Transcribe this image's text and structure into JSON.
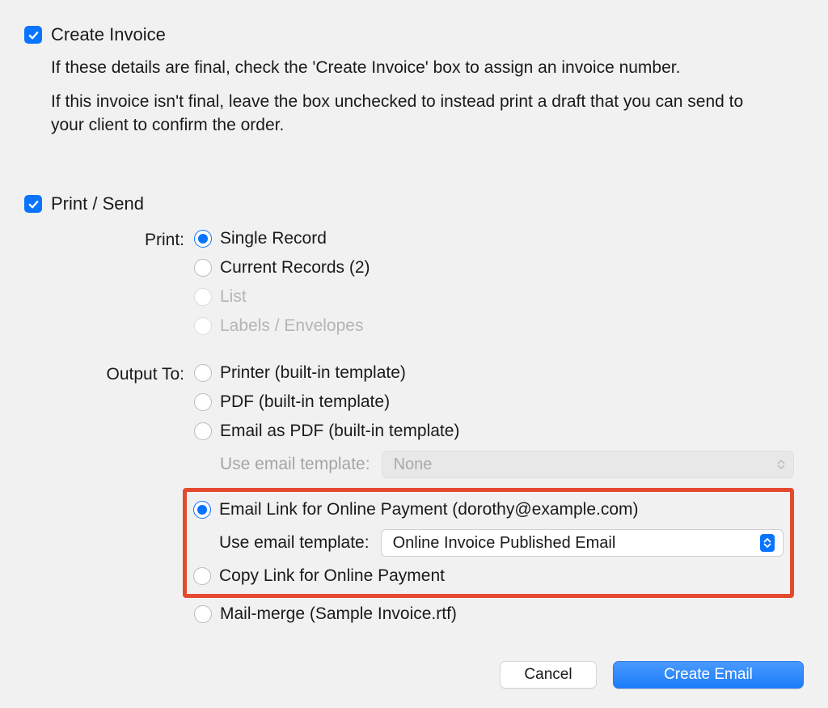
{
  "create_invoice": {
    "label": "Create Invoice",
    "description1": "If these details are final, check the 'Create Invoice' box to assign an invoice number.",
    "description2": "If this invoice isn't final, leave the box unchecked to instead print a draft that you can send to your client to confirm the order."
  },
  "print_send": {
    "label": "Print / Send",
    "print_label": "Print:",
    "output_label": "Output To:",
    "print_options": {
      "single_record": "Single Record",
      "current_records": "Current Records (2)",
      "list": "List",
      "labels": "Labels / Envelopes"
    },
    "output_options": {
      "printer": "Printer (built-in template)",
      "pdf": "PDF (built-in template)",
      "email_pdf": "Email as PDF (built-in template)",
      "email_template_label": "Use email template:",
      "email_template_none": "None",
      "email_link": "Email Link for Online Payment (dorothy@example.com)",
      "email_link_template": "Online Invoice Published Email",
      "copy_link": "Copy Link for Online Payment",
      "mail_merge": "Mail-merge (Sample Invoice.rtf)"
    }
  },
  "buttons": {
    "cancel": "Cancel",
    "create_email": "Create Email"
  }
}
